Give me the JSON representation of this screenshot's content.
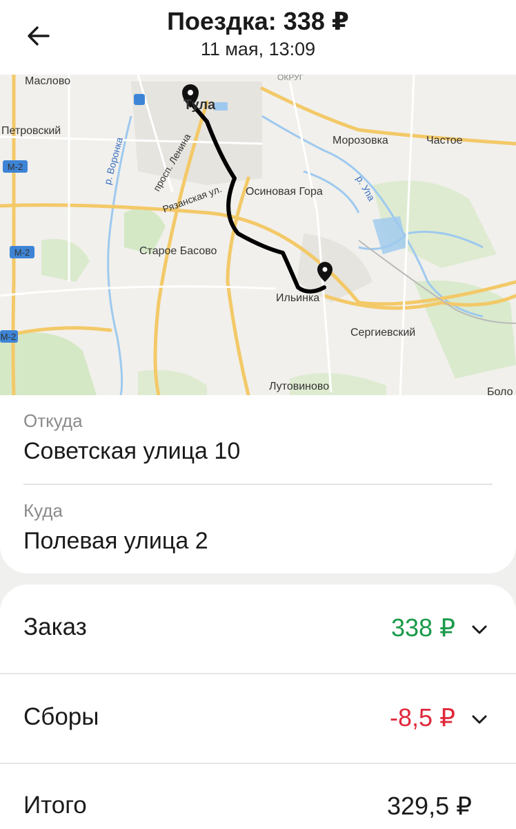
{
  "header": {
    "title": "Поездка: 338 ₽",
    "subtitle": "11 мая, 13:09",
    "back_icon": "arrow-left-icon"
  },
  "map": {
    "labels": {
      "maslovo": "Маслово",
      "tula": "Тула",
      "okrug": "ОКРУГ",
      "petrovsky": "Петровский",
      "morozovka": "Морозовка",
      "chastoe": "Частое",
      "voronka": "р. Воронка",
      "prosp_lenina": "просп. Ленина",
      "ryazanskaya": "Рязанская ул.",
      "osinovaya_gora": "Осиновая Гора",
      "upa": "р. Упа",
      "m2_a": "М-2",
      "m2_b": "М-2",
      "m2_c": "М-2",
      "staroe_basovo": "Старое Басово",
      "ilyinka": "Ильинка",
      "sergievsky": "Сергиевский",
      "lutovinovo": "Лутовиново",
      "bolo": "Боло"
    },
    "colors": {
      "road_major": "#f6c85f",
      "road_minor": "#ffffff",
      "water": "#9ec9ef",
      "green": "#cfe6bf",
      "route": "#000000"
    }
  },
  "trip": {
    "from_label": "Откуда",
    "from_value": "Советская улица 10",
    "to_label": "Куда",
    "to_value": "Полевая улица 2"
  },
  "payment": {
    "order_label": "Заказ",
    "order_value": "338 ₽",
    "order_color": "#1a9a4a",
    "fees_label": "Сборы",
    "fees_value": "-8,5 ₽",
    "fees_color": "#e0283a",
    "total_label": "Итого",
    "total_value": "329,5 ₽"
  }
}
